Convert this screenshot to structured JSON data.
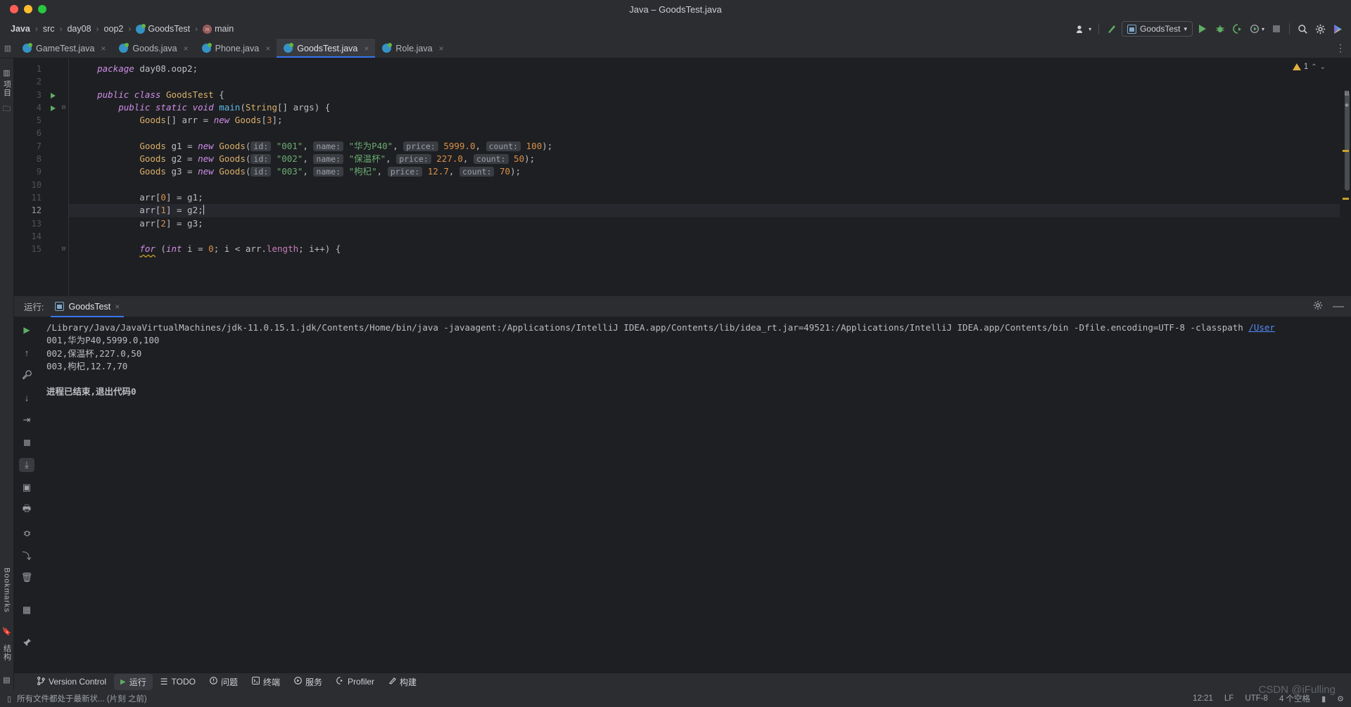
{
  "window": {
    "title": "Java – GoodsTest.java"
  },
  "traffic": {
    "close": "close-window",
    "minimize": "minimize-window",
    "maximize": "maximize-window"
  },
  "breadcrumb": {
    "items": [
      {
        "label": "Java",
        "icon": ""
      },
      {
        "label": "src",
        "icon": ""
      },
      {
        "label": "day08",
        "icon": ""
      },
      {
        "label": "oop2",
        "icon": ""
      },
      {
        "label": "GoodsTest",
        "icon": "class-icon"
      },
      {
        "label": "main",
        "icon": "method-icon"
      }
    ],
    "separator": "›"
  },
  "toolbar": {
    "account_label": "account-icon",
    "hammer_label": "build-icon",
    "run_config": "GoodsTest",
    "run_label": "run-button",
    "debug_label": "debug-button",
    "coverage_label": "run-with-coverage-button",
    "profiler_label": "profile-button",
    "stop_label": "stop-button",
    "search_label": "search-everywhere",
    "settings_label": "settings-button",
    "ai_label": "ai-assistant-button"
  },
  "tabs": [
    {
      "label": "GameTest.java",
      "icon": "java-class-runnable-icon",
      "active": false
    },
    {
      "label": "Goods.java",
      "icon": "java-class-icon",
      "active": false
    },
    {
      "label": "Phone.java",
      "icon": "java-class-icon",
      "active": false
    },
    {
      "label": "GoodsTest.java",
      "icon": "java-class-runnable-icon",
      "active": true
    },
    {
      "label": "Role.java",
      "icon": "java-class-icon",
      "active": false
    }
  ],
  "editor": {
    "warning_count": "1",
    "line_numbers": [
      "1",
      "2",
      "3",
      "4",
      "5",
      "6",
      "7",
      "8",
      "9",
      "10",
      "11",
      "12",
      "13",
      "14",
      "15"
    ],
    "run_markers": [
      3,
      4
    ],
    "fold_markers": [
      4,
      15
    ],
    "highlight_line": 12,
    "lines": [
      {
        "n": 1,
        "tokens": [
          {
            "t": "    ",
            "c": "pl"
          },
          {
            "t": "package",
            "c": "k"
          },
          {
            "t": " day08.oop2;",
            "c": "pl"
          }
        ]
      },
      {
        "n": 2,
        "tokens": []
      },
      {
        "n": 3,
        "tokens": [
          {
            "t": "    ",
            "c": "pl"
          },
          {
            "t": "public class",
            "c": "k"
          },
          {
            "t": " ",
            "c": "pl"
          },
          {
            "t": "GoodsTest",
            "c": "ty"
          },
          {
            "t": " {",
            "c": "pl"
          }
        ]
      },
      {
        "n": 4,
        "tokens": [
          {
            "t": "        ",
            "c": "pl"
          },
          {
            "t": "public static void",
            "c": "k"
          },
          {
            "t": " ",
            "c": "pl"
          },
          {
            "t": "main",
            "c": "mth"
          },
          {
            "t": "(",
            "c": "pl"
          },
          {
            "t": "String",
            "c": "ty"
          },
          {
            "t": "[] args) {",
            "c": "pl"
          }
        ]
      },
      {
        "n": 5,
        "tokens": [
          {
            "t": "            ",
            "c": "pl"
          },
          {
            "t": "Goods",
            "c": "ty"
          },
          {
            "t": "[] arr = ",
            "c": "pl"
          },
          {
            "t": "new",
            "c": "k"
          },
          {
            "t": " ",
            "c": "pl"
          },
          {
            "t": "Goods",
            "c": "ty"
          },
          {
            "t": "[",
            "c": "pl"
          },
          {
            "t": "3",
            "c": "numo"
          },
          {
            "t": "];",
            "c": "pl"
          }
        ]
      },
      {
        "n": 6,
        "tokens": []
      },
      {
        "n": 7,
        "tokens": [
          {
            "t": "            ",
            "c": "pl"
          },
          {
            "t": "Goods",
            "c": "ty"
          },
          {
            "t": " g1 = ",
            "c": "pl"
          },
          {
            "t": "new",
            "c": "k"
          },
          {
            "t": " ",
            "c": "pl"
          },
          {
            "t": "Goods",
            "c": "ty"
          },
          {
            "t": "(",
            "c": "pl"
          },
          {
            "t": "id:",
            "c": "hint"
          },
          {
            "t": " ",
            "c": "pl"
          },
          {
            "t": "\"001\"",
            "c": "str"
          },
          {
            "t": ", ",
            "c": "pl"
          },
          {
            "t": "name:",
            "c": "hint"
          },
          {
            "t": " ",
            "c": "pl"
          },
          {
            "t": "\"华为P40\"",
            "c": "str"
          },
          {
            "t": ", ",
            "c": "pl"
          },
          {
            "t": "price:",
            "c": "hint"
          },
          {
            "t": " ",
            "c": "pl"
          },
          {
            "t": "5999.0",
            "c": "numo"
          },
          {
            "t": ", ",
            "c": "pl"
          },
          {
            "t": "count:",
            "c": "hint"
          },
          {
            "t": " ",
            "c": "pl"
          },
          {
            "t": "100",
            "c": "numo"
          },
          {
            "t": ");",
            "c": "pl"
          }
        ]
      },
      {
        "n": 8,
        "tokens": [
          {
            "t": "            ",
            "c": "pl"
          },
          {
            "t": "Goods",
            "c": "ty"
          },
          {
            "t": " g2 = ",
            "c": "pl"
          },
          {
            "t": "new",
            "c": "k"
          },
          {
            "t": " ",
            "c": "pl"
          },
          {
            "t": "Goods",
            "c": "ty"
          },
          {
            "t": "(",
            "c": "pl"
          },
          {
            "t": "id:",
            "c": "hint"
          },
          {
            "t": " ",
            "c": "pl"
          },
          {
            "t": "\"002\"",
            "c": "str"
          },
          {
            "t": ", ",
            "c": "pl"
          },
          {
            "t": "name:",
            "c": "hint"
          },
          {
            "t": " ",
            "c": "pl"
          },
          {
            "t": "\"保温杯\"",
            "c": "str"
          },
          {
            "t": ", ",
            "c": "pl"
          },
          {
            "t": "price:",
            "c": "hint"
          },
          {
            "t": " ",
            "c": "pl"
          },
          {
            "t": "227.0",
            "c": "numo"
          },
          {
            "t": ", ",
            "c": "pl"
          },
          {
            "t": "count:",
            "c": "hint"
          },
          {
            "t": " ",
            "c": "pl"
          },
          {
            "t": "50",
            "c": "numo"
          },
          {
            "t": ");",
            "c": "pl"
          }
        ]
      },
      {
        "n": 9,
        "tokens": [
          {
            "t": "            ",
            "c": "pl"
          },
          {
            "t": "Goods",
            "c": "ty"
          },
          {
            "t": " g3 = ",
            "c": "pl"
          },
          {
            "t": "new",
            "c": "k"
          },
          {
            "t": " ",
            "c": "pl"
          },
          {
            "t": "Goods",
            "c": "ty"
          },
          {
            "t": "(",
            "c": "pl"
          },
          {
            "t": "id:",
            "c": "hint"
          },
          {
            "t": " ",
            "c": "pl"
          },
          {
            "t": "\"003\"",
            "c": "str"
          },
          {
            "t": ", ",
            "c": "pl"
          },
          {
            "t": "name:",
            "c": "hint"
          },
          {
            "t": " ",
            "c": "pl"
          },
          {
            "t": "\"枸杞\"",
            "c": "str"
          },
          {
            "t": ", ",
            "c": "pl"
          },
          {
            "t": "price:",
            "c": "hint"
          },
          {
            "t": " ",
            "c": "pl"
          },
          {
            "t": "12.7",
            "c": "numo"
          },
          {
            "t": ", ",
            "c": "pl"
          },
          {
            "t": "count:",
            "c": "hint"
          },
          {
            "t": " ",
            "c": "pl"
          },
          {
            "t": "70",
            "c": "numo"
          },
          {
            "t": ");",
            "c": "pl"
          }
        ]
      },
      {
        "n": 10,
        "tokens": []
      },
      {
        "n": 11,
        "tokens": [
          {
            "t": "            arr[",
            "c": "pl"
          },
          {
            "t": "0",
            "c": "numo"
          },
          {
            "t": "] = g1;",
            "c": "pl"
          }
        ]
      },
      {
        "n": 12,
        "tokens": [
          {
            "t": "            arr[",
            "c": "pl"
          },
          {
            "t": "1",
            "c": "numo"
          },
          {
            "t": "] = g2;",
            "c": "pl"
          },
          {
            "t": "caret",
            "c": "caret"
          }
        ]
      },
      {
        "n": 13,
        "tokens": [
          {
            "t": "            arr[",
            "c": "pl"
          },
          {
            "t": "2",
            "c": "numo"
          },
          {
            "t": "] = g3;",
            "c": "pl"
          }
        ]
      },
      {
        "n": 14,
        "tokens": []
      },
      {
        "n": 15,
        "tokens": [
          {
            "t": "            ",
            "c": "pl"
          },
          {
            "t": "for",
            "c": "kwavy"
          },
          {
            "t": " (",
            "c": "pl"
          },
          {
            "t": "int",
            "c": "k"
          },
          {
            "t": " i = ",
            "c": "pl"
          },
          {
            "t": "0",
            "c": "numo"
          },
          {
            "t": "; i < arr.",
            "c": "pl"
          },
          {
            "t": "length",
            "c": "fld"
          },
          {
            "t": "; i++) {",
            "c": "pl"
          }
        ]
      }
    ]
  },
  "run_panel": {
    "label": "运行:",
    "tab_label": "GoodsTest",
    "tab_close": "×",
    "settings_icon": "gear-icon",
    "minimize_icon": "minimize-icon",
    "tools": [
      {
        "name": "rerun-button",
        "glyph": "▶"
      },
      {
        "name": "scroll-up-button",
        "glyph": "↑"
      },
      {
        "name": "wrench-button",
        "glyph": "⚒"
      },
      {
        "name": "scroll-down-button",
        "glyph": "↓"
      },
      {
        "name": "soft-wrap-button",
        "glyph": "↩"
      },
      {
        "name": "stop-button",
        "glyph": "■"
      },
      {
        "name": "scroll-to-end-button",
        "glyph": "⤓"
      },
      {
        "name": "screenshot-button",
        "glyph": "▣"
      },
      {
        "name": "bug-button",
        "glyph": "☸"
      },
      {
        "name": "print-button",
        "glyph": "⎙"
      },
      {
        "name": "export-button",
        "glyph": "⏎"
      },
      {
        "name": "clear-all-button",
        "glyph": "Ὕ1"
      },
      {
        "name": "layout-button",
        "glyph": "▦"
      },
      {
        "name": "pin-button",
        "glyph": "⚑"
      }
    ],
    "console": {
      "command_prefix": "/Library/Java/JavaVirtualMachines/jdk-11.0.15.1.jdk/Contents/Home/bin/java -javaagent:/Applications/IntelliJ IDEA.app/Contents/lib/idea_rt.jar=49521:/Applications/IntelliJ IDEA.app/Contents/bin -Dfile.encoding=UTF-8 -classpath ",
      "command_link": "/User",
      "output_lines": [
        "001,华为P40,5999.0,100",
        "002,保温杯,227.0,50",
        "003,枸杞,12.7,70",
        ""
      ],
      "exit_line": "进程已结束,退出代码0"
    }
  },
  "toolwindow_bar": {
    "items": [
      {
        "label": "Version Control",
        "icon": "branch-icon",
        "active": false
      },
      {
        "label": "运行",
        "icon": "run-icon",
        "active": true
      },
      {
        "label": "TODO",
        "icon": "list-icon",
        "active": false
      },
      {
        "label": "问题",
        "icon": "warning-icon",
        "active": false
      },
      {
        "label": "终端",
        "icon": "terminal-icon",
        "active": false
      },
      {
        "label": "服务",
        "icon": "services-icon",
        "active": false
      },
      {
        "label": "Profiler",
        "icon": "profiler-icon",
        "active": false
      },
      {
        "label": "构建",
        "icon": "hammer-icon",
        "active": false
      }
    ]
  },
  "left_bar": {
    "project_label": "项目",
    "bookmarks_label": "Bookmarks",
    "structure_label": "结构"
  },
  "status_bar": {
    "message": "所有文件都处于最新状... (片刻 之前)",
    "time": "12:21",
    "line_sep": "LF",
    "encoding": "UTF-8",
    "indent": "4 个空格",
    "lock_icon": "lock-icon",
    "inspection_icon": "inspection-icon"
  },
  "watermark": "CSDN @iFulling",
  "colors": {
    "bg_panel": "#2b2d30",
    "bg_editor": "#1e1f22",
    "accent_blue": "#3574f0",
    "green": "#5fad65",
    "string_green": "#6aab73",
    "keyword_purple": "#cf8ee8",
    "type_gold": "#d9b06c",
    "number_orange": "#d9904a",
    "link_blue": "#548af7"
  }
}
